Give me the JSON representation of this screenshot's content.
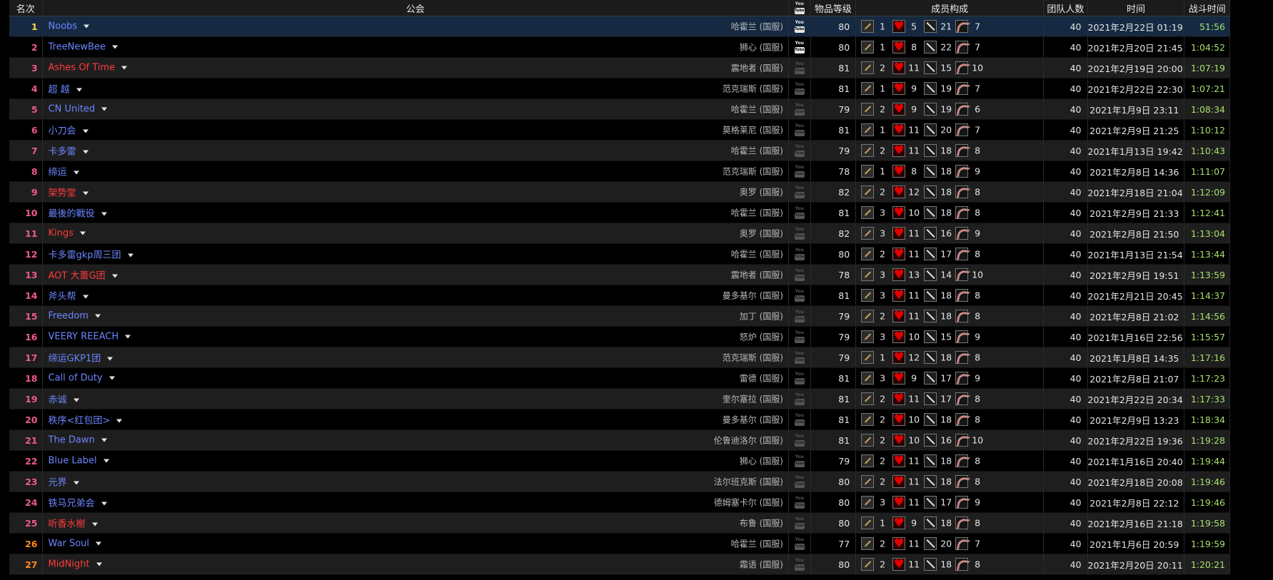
{
  "headers": {
    "rank": "名次",
    "guild": "公会",
    "video": "video-icon",
    "ilvl": "物品等级",
    "composition": "成员构成",
    "size": "团队人数",
    "time": "时间",
    "duration": "战斗时间"
  },
  "role_icons": [
    "tank-icon",
    "healer-icon",
    "melee-icon",
    "ranged-icon"
  ],
  "colors": {
    "rank_default": "#f05a8c",
    "rank_first": "#ffd541",
    "rank_orange": "#ff8a1f",
    "guild_blue": "#6b86ff",
    "guild_red": "#ff3b3b",
    "duration": "#a8e06c",
    "selected_row": "#152a42"
  },
  "rows": [
    {
      "rank": "1",
      "guild": "Noobs",
      "guild_color": "blue",
      "server": "哈霍兰 (国服)",
      "video": true,
      "ilvl": "80",
      "tank": "1",
      "heal": "5",
      "melee": "21",
      "ranged": "7",
      "size": "40",
      "time": "2021年2月22日 01:19",
      "duration": "51:56"
    },
    {
      "rank": "2",
      "guild": "TreeNewBee",
      "guild_color": "blue",
      "server": "狮心 (国服)",
      "video": true,
      "ilvl": "80",
      "tank": "1",
      "heal": "8",
      "melee": "22",
      "ranged": "7",
      "size": "40",
      "time": "2021年2月20日 21:45",
      "duration": "1:04:52"
    },
    {
      "rank": "3",
      "guild": "Ashes Of Time",
      "guild_color": "red",
      "server": "震地者 (国服)",
      "video": false,
      "ilvl": "81",
      "tank": "2",
      "heal": "11",
      "melee": "15",
      "ranged": "10",
      "size": "40",
      "time": "2021年2月19日 20:00",
      "duration": "1:07:19"
    },
    {
      "rank": "4",
      "guild": "超 越",
      "guild_color": "blue",
      "server": "范克瑞斯 (国服)",
      "video": false,
      "ilvl": "81",
      "tank": "1",
      "heal": "9",
      "melee": "19",
      "ranged": "7",
      "size": "40",
      "time": "2021年2月22日 22:30",
      "duration": "1:07:21"
    },
    {
      "rank": "5",
      "guild": "CN United",
      "guild_color": "blue",
      "server": "哈霍兰 (国服)",
      "video": false,
      "ilvl": "79",
      "tank": "2",
      "heal": "9",
      "melee": "19",
      "ranged": "6",
      "size": "40",
      "time": "2021年1月9日 23:11",
      "duration": "1:08:34"
    },
    {
      "rank": "6",
      "guild": "小刀会",
      "guild_color": "blue",
      "server": "莫格莱尼 (国服)",
      "video": false,
      "ilvl": "81",
      "tank": "1",
      "heal": "11",
      "melee": "20",
      "ranged": "7",
      "size": "40",
      "time": "2021年2月9日 21:25",
      "duration": "1:10:12"
    },
    {
      "rank": "7",
      "guild": "卡多雷",
      "guild_color": "blue",
      "server": "哈霍兰 (国服)",
      "video": false,
      "ilvl": "79",
      "tank": "2",
      "heal": "11",
      "melee": "18",
      "ranged": "8",
      "size": "40",
      "time": "2021年1月13日 19:42",
      "duration": "1:10:43"
    },
    {
      "rank": "8",
      "guild": "缔运",
      "guild_color": "blue",
      "server": "范克瑞斯 (国服)",
      "video": false,
      "ilvl": "78",
      "tank": "1",
      "heal": "8",
      "melee": "18",
      "ranged": "9",
      "size": "40",
      "time": "2021年2月8日 14:36",
      "duration": "1:11:07"
    },
    {
      "rank": "9",
      "guild": "架势堂",
      "guild_color": "red",
      "server": "奥罗 (国服)",
      "video": false,
      "ilvl": "82",
      "tank": "2",
      "heal": "12",
      "melee": "18",
      "ranged": "8",
      "size": "40",
      "time": "2021年2月18日 21:04",
      "duration": "1:12:09"
    },
    {
      "rank": "10",
      "guild": "最後的戰役",
      "guild_color": "blue",
      "server": "哈霍兰 (国服)",
      "video": false,
      "ilvl": "81",
      "tank": "3",
      "heal": "10",
      "melee": "18",
      "ranged": "8",
      "size": "40",
      "time": "2021年2月9日 21:33",
      "duration": "1:12:41"
    },
    {
      "rank": "11",
      "guild": "Kings",
      "guild_color": "red",
      "server": "奥罗 (国服)",
      "video": false,
      "ilvl": "82",
      "tank": "3",
      "heal": "11",
      "melee": "16",
      "ranged": "9",
      "size": "40",
      "time": "2021年2月8日 21:50",
      "duration": "1:13:04"
    },
    {
      "rank": "12",
      "guild": "卡多雷gkp周三团",
      "guild_color": "blue",
      "server": "哈霍兰 (国服)",
      "video": false,
      "ilvl": "80",
      "tank": "2",
      "heal": "11",
      "melee": "17",
      "ranged": "8",
      "size": "40",
      "time": "2021年1月13日 21:54",
      "duration": "1:13:44"
    },
    {
      "rank": "13",
      "guild": "AOT 大蕾G团",
      "guild_color": "red",
      "server": "震地者 (国服)",
      "video": false,
      "ilvl": "78",
      "tank": "3",
      "heal": "13",
      "melee": "14",
      "ranged": "10",
      "size": "40",
      "time": "2021年2月9日 19:51",
      "duration": "1:13:59"
    },
    {
      "rank": "14",
      "guild": "斧头帮",
      "guild_color": "blue",
      "server": "曼多基尔 (国服)",
      "video": false,
      "ilvl": "81",
      "tank": "3",
      "heal": "11",
      "melee": "18",
      "ranged": "8",
      "size": "40",
      "time": "2021年2月21日 20:45",
      "duration": "1:14:37"
    },
    {
      "rank": "15",
      "guild": "Freedom",
      "guild_color": "blue",
      "server": "加丁 (国服)",
      "video": false,
      "ilvl": "79",
      "tank": "2",
      "heal": "11",
      "melee": "18",
      "ranged": "8",
      "size": "40",
      "time": "2021年2月8日 21:02",
      "duration": "1:14:56"
    },
    {
      "rank": "16",
      "guild": "VEERY REEACH",
      "guild_color": "blue",
      "server": "怒炉 (国服)",
      "video": false,
      "ilvl": "79",
      "tank": "3",
      "heal": "10",
      "melee": "15",
      "ranged": "9",
      "size": "40",
      "time": "2021年1月16日 22:56",
      "duration": "1:15:57"
    },
    {
      "rank": "17",
      "guild": "缔运GKP1团",
      "guild_color": "blue",
      "server": "范克瑞斯 (国服)",
      "video": false,
      "ilvl": "79",
      "tank": "1",
      "heal": "12",
      "melee": "18",
      "ranged": "8",
      "size": "40",
      "time": "2021年1月8日 14:35",
      "duration": "1:17:16"
    },
    {
      "rank": "18",
      "guild": "Call of Duty",
      "guild_color": "blue",
      "server": "雷德 (国服)",
      "video": false,
      "ilvl": "81",
      "tank": "3",
      "heal": "9",
      "melee": "17",
      "ranged": "9",
      "size": "40",
      "time": "2021年2月8日 21:07",
      "duration": "1:17:23"
    },
    {
      "rank": "19",
      "guild": "赤诚",
      "guild_color": "blue",
      "server": "奎尔塞拉 (国服)",
      "video": false,
      "ilvl": "81",
      "tank": "2",
      "heal": "11",
      "melee": "17",
      "ranged": "8",
      "size": "40",
      "time": "2021年2月22日 20:34",
      "duration": "1:17:33"
    },
    {
      "rank": "20",
      "guild": "秩序<红包团>",
      "guild_color": "blue",
      "server": "曼多基尔 (国服)",
      "video": false,
      "ilvl": "81",
      "tank": "2",
      "heal": "10",
      "melee": "18",
      "ranged": "8",
      "size": "40",
      "time": "2021年2月9日 13:23",
      "duration": "1:18:34"
    },
    {
      "rank": "21",
      "guild": "The Dawn",
      "guild_color": "blue",
      "server": "伦鲁迪洛尔 (国服)",
      "video": false,
      "ilvl": "81",
      "tank": "2",
      "heal": "10",
      "melee": "16",
      "ranged": "10",
      "size": "40",
      "time": "2021年2月22日 19:36",
      "duration": "1:19:28"
    },
    {
      "rank": "22",
      "guild": "Blue Label",
      "guild_color": "blue",
      "server": "狮心 (国服)",
      "video": false,
      "ilvl": "79",
      "tank": "2",
      "heal": "11",
      "melee": "18",
      "ranged": "8",
      "size": "40",
      "time": "2021年1月16日 20:40",
      "duration": "1:19:44"
    },
    {
      "rank": "23",
      "guild": "元界",
      "guild_color": "blue",
      "server": "法尔班克斯 (国服)",
      "video": false,
      "ilvl": "80",
      "tank": "2",
      "heal": "11",
      "melee": "18",
      "ranged": "8",
      "size": "40",
      "time": "2021年2月18日 20:08",
      "duration": "1:19:46"
    },
    {
      "rank": "24",
      "guild": "铁马兄弟会",
      "guild_color": "blue",
      "server": "德姆塞卡尔 (国服)",
      "video": false,
      "ilvl": "80",
      "tank": "3",
      "heal": "11",
      "melee": "17",
      "ranged": "9",
      "size": "40",
      "time": "2021年2月8日 22:12",
      "duration": "1:19:46"
    },
    {
      "rank": "25",
      "guild": "听香水榭",
      "guild_color": "red",
      "server": "布鲁 (国服)",
      "video": false,
      "ilvl": "80",
      "tank": "1",
      "heal": "9",
      "melee": "18",
      "ranged": "8",
      "size": "40",
      "time": "2021年2月16日 21:18",
      "duration": "1:19:58"
    },
    {
      "rank": "26",
      "guild": "War Soul",
      "guild_color": "blue",
      "server": "哈霍兰 (国服)",
      "video": false,
      "ilvl": "77",
      "tank": "2",
      "heal": "11",
      "melee": "20",
      "ranged": "7",
      "size": "40",
      "time": "2021年1月6日 20:59",
      "duration": "1:19:59"
    },
    {
      "rank": "27",
      "guild": "MidNight",
      "guild_color": "red",
      "server": "霜语 (国服)",
      "video": false,
      "ilvl": "80",
      "tank": "2",
      "heal": "11",
      "melee": "18",
      "ranged": "8",
      "size": "40",
      "time": "2021年2月20日 20:11",
      "duration": "1:20:21"
    }
  ]
}
